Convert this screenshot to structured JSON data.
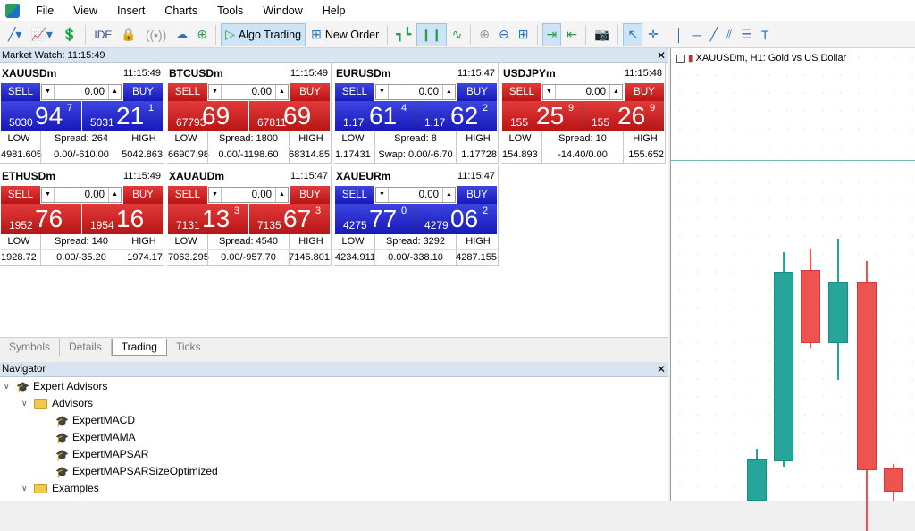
{
  "menu": [
    "File",
    "View",
    "Insert",
    "Charts",
    "Tools",
    "Window",
    "Help"
  ],
  "toolbar": {
    "ide": "IDE",
    "algo_trading": "Algo Trading",
    "new_order": "New Order"
  },
  "market_watch": {
    "title": "Market Watch: 11:15:49",
    "labels": {
      "sell": "SELL",
      "buy": "BUY",
      "low": "LOW",
      "high": "HIGH"
    },
    "tiles": [
      {
        "symbol": "XAUUSDm",
        "time": "11:15:49",
        "lot": "0.00",
        "color": "blue",
        "sell_small": "5030",
        "sell_big": "94",
        "sell_sup": "7",
        "buy_small": "5031",
        "buy_big": "21",
        "buy_sup": "1",
        "spread": "Spread: 264",
        "low": "4981.605",
        "swap": "0.00/-610.00",
        "high": "5042.863"
      },
      {
        "symbol": "BTCUSDm",
        "time": "11:15:49",
        "lot": "0.00",
        "color": "red",
        "sell_small": "67793",
        "sell_big": "69",
        "sell_sup": "",
        "buy_small": "67811",
        "buy_big": "69",
        "buy_sup": "",
        "spread": "Spread: 1800",
        "low": "66907.98",
        "swap": "0.00/-1198.60",
        "high": "68314.85"
      },
      {
        "symbol": "EURUSDm",
        "time": "11:15:47",
        "lot": "0.00",
        "color": "blue",
        "sell_small": "1.17",
        "sell_big": "61",
        "sell_sup": "4",
        "buy_small": "1.17",
        "buy_big": "62",
        "buy_sup": "2",
        "spread": "Spread: 8",
        "low": "1.17431",
        "swap": "Swap: 0.00/-6.70",
        "high": "1.17728"
      },
      {
        "symbol": "USDJPYm",
        "time": "11:15:48",
        "lot": "0.00",
        "color": "red",
        "sell_small": "155",
        "sell_big": "25",
        "sell_sup": "9",
        "buy_small": "155",
        "buy_big": "26",
        "buy_sup": "9",
        "spread": "Spread: 10",
        "low": "154.893",
        "swap": "-14.40/0.00",
        "high": "155.652"
      },
      {
        "symbol": "ETHUSDm",
        "time": "11:15:49",
        "lot": "0.00",
        "color": "red",
        "sell_small": "1952",
        "sell_big": "76",
        "sell_sup": "",
        "buy_small": "1954",
        "buy_big": "16",
        "buy_sup": "",
        "spread": "Spread: 140",
        "low": "1928.72",
        "swap": "0.00/-35.20",
        "high": "1974.17"
      },
      {
        "symbol": "XAUAUDm",
        "time": "11:15:47",
        "lot": "0.00",
        "color": "red",
        "sell_small": "7131",
        "sell_big": "13",
        "sell_sup": "3",
        "buy_small": "7135",
        "buy_big": "67",
        "buy_sup": "3",
        "spread": "Spread: 4540",
        "low": "7063.295",
        "swap": "0.00/-957.70",
        "high": "7145.801"
      },
      {
        "symbol": "XAUEURm",
        "time": "11:15:47",
        "lot": "0.00",
        "color": "blue",
        "sell_small": "4275",
        "sell_big": "77",
        "sell_sup": "0",
        "buy_small": "4279",
        "buy_big": "06",
        "buy_sup": "2",
        "spread": "Spread: 3292",
        "low": "4234.911",
        "swap": "0.00/-338.10",
        "high": "4287.155"
      }
    ]
  },
  "tabs": [
    {
      "label": "Symbols",
      "active": false
    },
    {
      "label": "Details",
      "active": false
    },
    {
      "label": "Trading",
      "active": true
    },
    {
      "label": "Ticks",
      "active": false
    }
  ],
  "navigator": {
    "title": "Navigator",
    "items": [
      {
        "label": "Expert Advisors",
        "type": "cap-root"
      },
      {
        "label": "Advisors",
        "type": "folder"
      },
      {
        "label": "ExpertMACD",
        "type": "cap"
      },
      {
        "label": "ExpertMAMA",
        "type": "cap"
      },
      {
        "label": "ExpertMAPSAR",
        "type": "cap"
      },
      {
        "label": "ExpertMAPSARSizeOptimized",
        "type": "cap"
      },
      {
        "label": "Examples",
        "type": "folder"
      }
    ]
  },
  "chart": {
    "title": "XAUUSDm, H1:  Gold vs US Dollar",
    "colors": {
      "bull": "#26a69a",
      "bear": "#ef5350"
    }
  }
}
